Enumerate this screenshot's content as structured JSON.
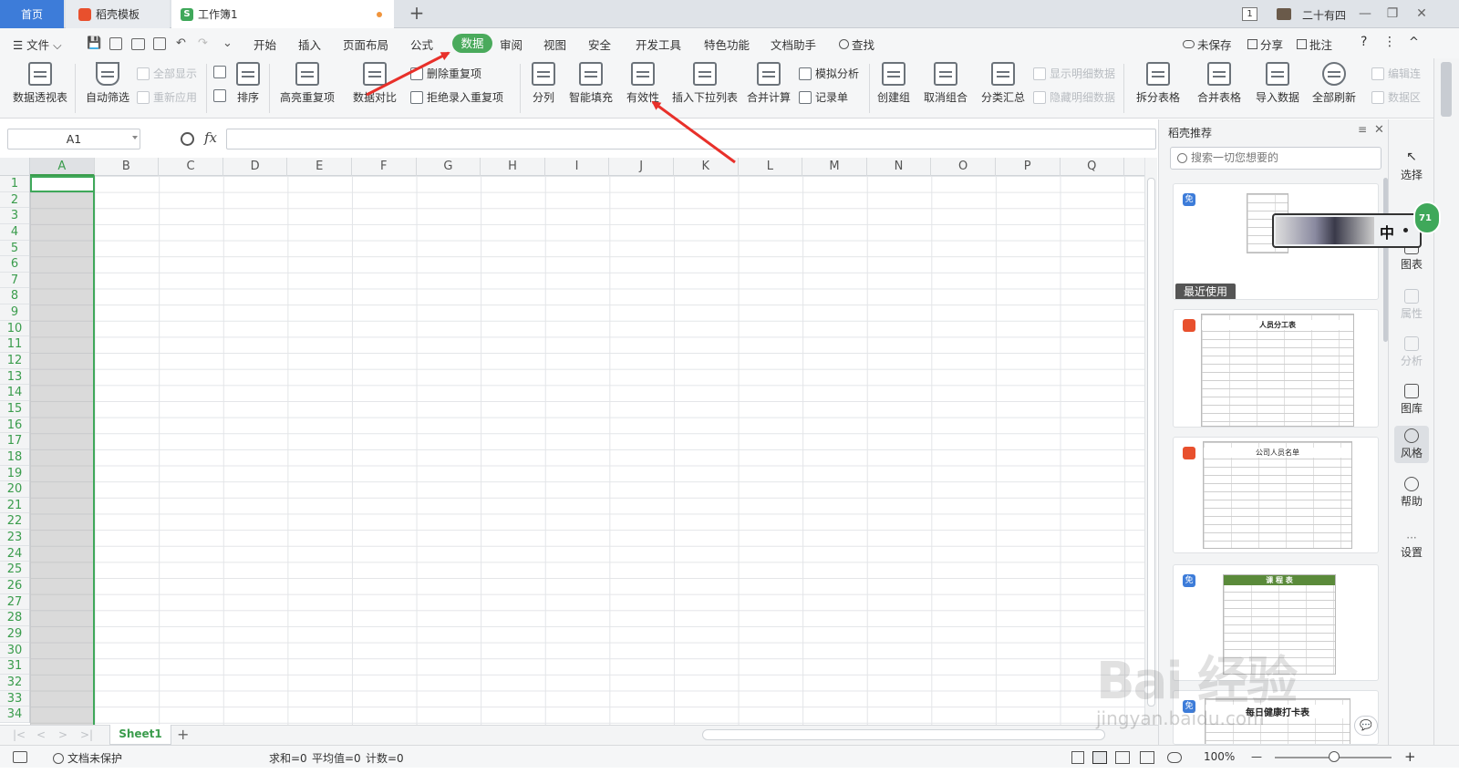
{
  "titlebar": {
    "home_tab": "首页",
    "template_tab": "稻壳模板",
    "workbook_tab": "工作簿1",
    "workbook_icon": "S",
    "new_tab": "+",
    "window_badge": "1",
    "user_name": "二十有四",
    "btn_minimize": "—",
    "btn_restore": "❐",
    "btn_close": "✕"
  },
  "menubar": {
    "file": "☰ 文件 ⌵",
    "items": [
      "开始",
      "插入",
      "页面布局",
      "公式",
      "数据",
      "审阅",
      "视图",
      "安全",
      "开发工具",
      "特色功能",
      "文档助手"
    ],
    "search": "查找",
    "unsaved": "未保存",
    "share": "分享",
    "annotate": "批注",
    "help": "?",
    "more": "⋮",
    "collapse": "^",
    "tool_save": "💾",
    "tool_undo": "↶",
    "tool_redo": "↷",
    "tool_more": "⌄"
  },
  "ribbon": {
    "pivot": "数据透视表",
    "autofilter": "自动筛选",
    "show_all": "全部显示",
    "reapply": "重新应用",
    "sort": "排序",
    "highlight_dup": "高亮重复项",
    "data_compare": "数据对比",
    "remove_dup": "删除重复项",
    "reject_dup": "拒绝录入重复项",
    "split_col": "分列",
    "smart_fill": "智能填充",
    "validity": "有效性",
    "dropdown": "插入下拉列表",
    "consolidate": "合并计算",
    "simulate": "模拟分析",
    "record": "记录单",
    "create_group": "创建组",
    "ungroup": "取消组合",
    "subtotal": "分类汇总",
    "show_detail": "显示明细数据",
    "hide_detail": "隐藏明细数据",
    "split_table": "拆分表格",
    "merge_table": "合并表格",
    "import_data": "导入数据",
    "refresh_all": "全部刷新",
    "edit_link": "编辑连",
    "data_src": "数据区"
  },
  "formula": {
    "cell_ref": "A1",
    "fx": "fx",
    "value": ""
  },
  "grid": {
    "columns": [
      "A",
      "B",
      "C",
      "D",
      "E",
      "F",
      "G",
      "H",
      "I",
      "J",
      "K",
      "L",
      "M",
      "N",
      "O",
      "P",
      "Q"
    ],
    "rows": [
      "1",
      "2",
      "3",
      "4",
      "5",
      "6",
      "7",
      "8",
      "9",
      "10",
      "11",
      "12",
      "13",
      "14",
      "15",
      "16",
      "17",
      "18",
      "19",
      "20",
      "21",
      "22",
      "23",
      "24",
      "25",
      "26",
      "27",
      "28",
      "29",
      "30",
      "31",
      "32",
      "33",
      "34"
    ]
  },
  "sheets": {
    "active": "Sheet1",
    "add": "+",
    "nav": [
      "|<",
      "<",
      ">",
      ">|"
    ]
  },
  "status": {
    "protect": "文档未保护",
    "sum": "求和=0",
    "avg": "平均值=0",
    "count": "计数=0",
    "zoom": "100%",
    "zoom_minus": "—",
    "zoom_plus": "+"
  },
  "panel": {
    "title": "稻壳推荐",
    "search_placeholder": "搜索一切您想要的",
    "recent": "最近使用",
    "badge_free": "免",
    "card2_title": "人员分工表",
    "card3_title": "公司人员名单",
    "card4_title": "课 程 表",
    "card5_title": "每日健康打卡表",
    "ime_char": "中",
    "green_badge": "71"
  },
  "sidebar": {
    "select": "选择",
    "chart": "图表",
    "property": "属性",
    "analysis": "分析",
    "gallery": "图库",
    "style": "风格",
    "help": "帮助",
    "settings": "设置",
    "more_dots": "···"
  },
  "watermark": {
    "text": "Bai 经验",
    "url": "jingyan.baidu.com"
  },
  "colors": {
    "accent_green": "#4aaa5c",
    "home_blue": "#3d7cd9",
    "arrow_red": "#e8302a"
  }
}
